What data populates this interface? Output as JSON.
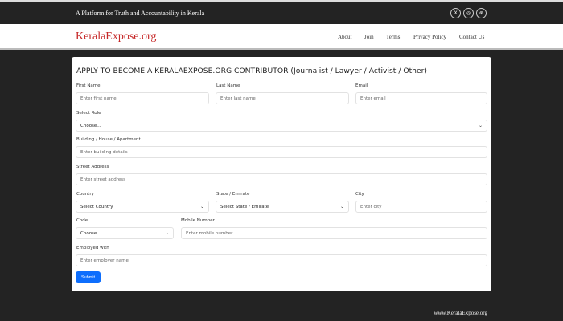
{
  "topbar": {
    "tagline": "A Platform for Truth and Accountability in Kerala",
    "social": [
      "X",
      "◎",
      "⊗"
    ]
  },
  "nav": {
    "logo": "KeralaExpose.org",
    "links": [
      "About",
      "Join",
      "Terms",
      "Privacy Policy",
      "Contact Us"
    ]
  },
  "form": {
    "title": "APPLY TO BECOME A KERALAEXPOSE.ORG CONTRIBUTOR (Journalist / Lawyer / Activist / Other)",
    "first_name": {
      "label": "First Name",
      "placeholder": "Enter first name"
    },
    "last_name": {
      "label": "Last Name",
      "placeholder": "Enter last name"
    },
    "email": {
      "label": "Email",
      "placeholder": "Enter email"
    },
    "role": {
      "label": "Select Role",
      "value": "Choose..."
    },
    "building": {
      "label": "Building / House / Apartment",
      "placeholder": "Enter building details"
    },
    "street": {
      "label": "Street Address",
      "placeholder": "Enter street address"
    },
    "country": {
      "label": "Country",
      "value": "Select Country"
    },
    "state": {
      "label": "State / Emirate",
      "value": "Select State / Emirate"
    },
    "city": {
      "label": "City",
      "placeholder": "Enter city"
    },
    "code": {
      "label": "Code",
      "value": "Choose..."
    },
    "mobile": {
      "label": "Mobile Number",
      "placeholder": "Enter mobile number"
    },
    "employer": {
      "label": "Employed with",
      "placeholder": "Enter employer name"
    },
    "submit": "Submit"
  },
  "footer": "www.KeralaExpose.org"
}
